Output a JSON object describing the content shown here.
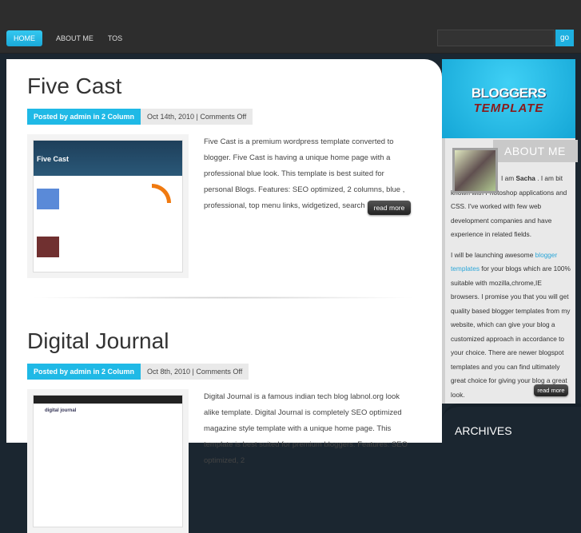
{
  "nav": {
    "items": [
      {
        "label": "HOME",
        "active": true
      },
      {
        "label": "ABOUT ME"
      },
      {
        "label": "TOS"
      }
    ],
    "search_placeholder": "",
    "go_label": "go"
  },
  "posts": [
    {
      "title": "Five Cast",
      "posted_by": "Posted by admin in 2 Column",
      "date_comments": "Oct 14th, 2010 | Comments Off",
      "excerpt": "Five Cast is a premium wordpress template converted to blogger. Five Cast is having a unique home page with a professional blue look. This template is best suited for personal Blogs. Features: SEO optimized, 2 columns, blue , professional, top menu links, widgetized, search box.",
      "read_more": "read more",
      "thumb_title": "Five Cast"
    },
    {
      "title": "Digital Journal",
      "posted_by": "Posted by admin in 2 Column",
      "date_comments": "Oct 8th, 2010 | Comments Off",
      "excerpt": "Digital Journal is a famous indian tech blog labnol.org look alike template. Digital Journal is completely SEO optimized magazine style template with a unique home page. This template is best suited for premium bloggers. Features: SEO optimized, 2",
      "thumb_title": "digital journal"
    }
  ],
  "sidebar": {
    "logo": {
      "line1": "BLOGGERS",
      "line2": "TEMPLATE"
    },
    "about": {
      "heading": "ABOUT ME",
      "p1_pre": "I am ",
      "name": "Sacha",
      "p1_post": " . I am bit known with Photoshop applications and CSS. I've worked with few web development companies and have experience in related fields.",
      "p2_pre": "I will be launching awesome ",
      "link": "blogger templates",
      "p2_post": " for your blogs which are 100% suitable with mozilla,chrome,IE browsers. I promise you that you will get quality based blogger templates from my website, which can give your blog a customized approach in accordance to your choice. There are newer blogspot templates and you can find ultimately great choice for giving your blog a great look.",
      "read_more": "read more"
    },
    "archives_heading": "ARCHIVES"
  },
  "colors": {
    "accent": "#1fb9e6",
    "topbar": "#2d2d2d",
    "background": "#1b2630"
  }
}
